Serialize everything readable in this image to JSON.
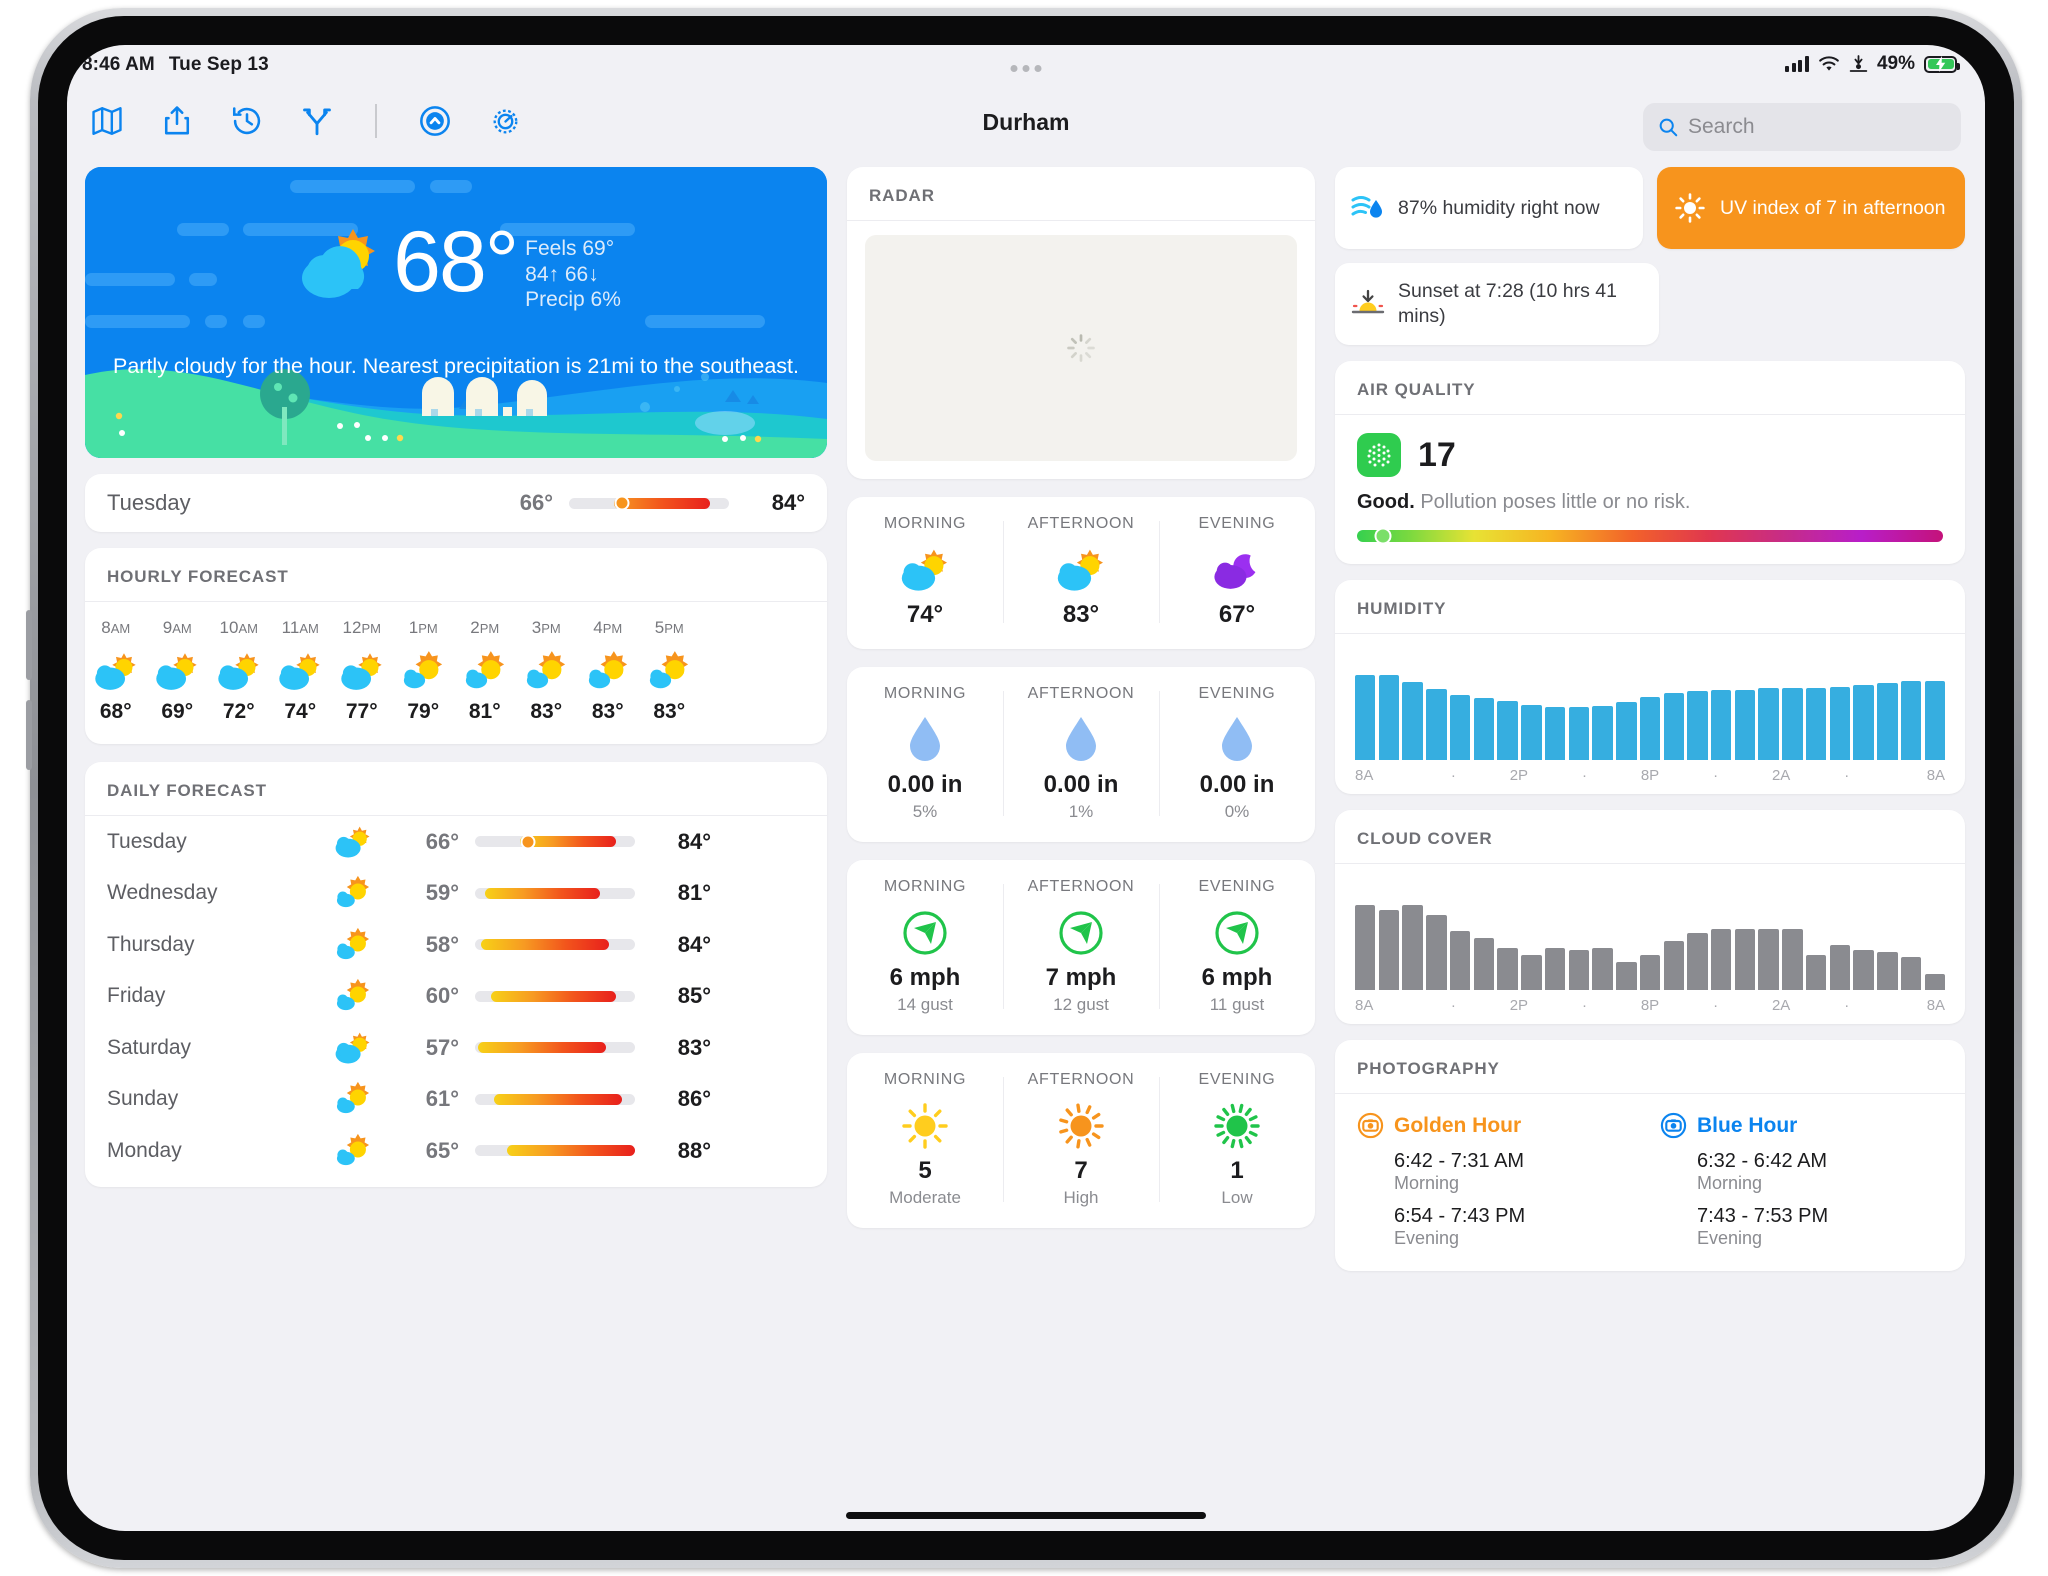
{
  "status_bar": {
    "time": "8:46 AM",
    "date": "Tue Sep 13",
    "battery": "49%"
  },
  "toolbar": {
    "icons": [
      "map-icon",
      "share-icon",
      "history-icon",
      "fork-icon",
      "compass-up-icon",
      "gear-icon"
    ],
    "location_title": "Durham"
  },
  "search": {
    "placeholder": "Search"
  },
  "hero": {
    "temperature": "68°",
    "feels": "Feels 69°",
    "highlow": "84↑ 66↓",
    "precip": "Precip 6%",
    "description": "Partly cloudy for the hour. Nearest precipitation is 21mi to the southeast."
  },
  "today_bar": {
    "day": "Tuesday",
    "low": "66°",
    "high": "84°"
  },
  "hourly": {
    "title": "HOURLY FORECAST",
    "items": [
      {
        "hour": "8",
        "ampm": "AM",
        "temp": "68°",
        "icon": "partly-cloudy-icon"
      },
      {
        "hour": "9",
        "ampm": "AM",
        "temp": "69°",
        "icon": "partly-cloudy-icon"
      },
      {
        "hour": "10",
        "ampm": "AM",
        "temp": "72°",
        "icon": "partly-cloudy-icon"
      },
      {
        "hour": "11",
        "ampm": "AM",
        "temp": "74°",
        "icon": "partly-cloudy-icon"
      },
      {
        "hour": "12",
        "ampm": "PM",
        "temp": "77°",
        "icon": "partly-cloudy-icon"
      },
      {
        "hour": "1",
        "ampm": "PM",
        "temp": "79°",
        "icon": "mostly-sunny-icon"
      },
      {
        "hour": "2",
        "ampm": "PM",
        "temp": "81°",
        "icon": "mostly-sunny-icon"
      },
      {
        "hour": "3",
        "ampm": "PM",
        "temp": "83°",
        "icon": "mostly-sunny-icon"
      },
      {
        "hour": "4",
        "ampm": "PM",
        "temp": "83°",
        "icon": "mostly-sunny-icon"
      },
      {
        "hour": "5",
        "ampm": "PM",
        "temp": "83°",
        "icon": "mostly-sunny-icon"
      }
    ]
  },
  "daily": {
    "title": "DAILY FORECAST",
    "rows": [
      {
        "day": "Tuesday",
        "low": "66°",
        "high": "84°",
        "icon": "partly-cloudy-icon",
        "bar_start": 28,
        "bar_end": 88,
        "dot": 33
      },
      {
        "day": "Wednesday",
        "low": "59°",
        "high": "81°",
        "icon": "mostly-sunny-icon",
        "bar_start": 6,
        "bar_end": 78,
        "dot": null
      },
      {
        "day": "Thursday",
        "low": "58°",
        "high": "84°",
        "icon": "mostly-sunny-icon",
        "bar_start": 4,
        "bar_end": 84,
        "dot": null
      },
      {
        "day": "Friday",
        "low": "60°",
        "high": "85°",
        "icon": "mostly-sunny-icon",
        "bar_start": 10,
        "bar_end": 88,
        "dot": null
      },
      {
        "day": "Saturday",
        "low": "57°",
        "high": "83°",
        "icon": "partly-cloudy-icon",
        "bar_start": 2,
        "bar_end": 82,
        "dot": null
      },
      {
        "day": "Sunday",
        "low": "61°",
        "high": "86°",
        "icon": "mostly-sunny-icon",
        "bar_start": 12,
        "bar_end": 92,
        "dot": null
      },
      {
        "day": "Monday",
        "low": "65°",
        "high": "88°",
        "icon": "mostly-sunny-icon",
        "bar_start": 20,
        "bar_end": 100,
        "dot": null
      }
    ]
  },
  "radar": {
    "title": "RADAR",
    "state": "loading"
  },
  "periods": [
    "MORNING",
    "AFTERNOON",
    "EVENING"
  ],
  "temps_panel": {
    "values": [
      "74°",
      "83°",
      "67°"
    ],
    "icons": [
      "partly-cloudy-icon",
      "partly-cloudy-icon",
      "partly-cloudy-night-icon"
    ]
  },
  "precip_panel": {
    "values": [
      "0.00 in",
      "0.00 in",
      "0.00 in"
    ],
    "subs": [
      "5%",
      "1%",
      "0%"
    ],
    "icon": "raindrop-icon"
  },
  "wind_panel": {
    "values": [
      "6 mph",
      "7 mph",
      "6 mph"
    ],
    "subs": [
      "14 gust",
      "12 gust",
      "11 gust"
    ],
    "icon": "wind-compass-icon"
  },
  "uv_panel": {
    "values": [
      "5",
      "7",
      "1"
    ],
    "subs": [
      "Moderate",
      "High",
      "Low"
    ],
    "icons": [
      "uv-sun-yellow-icon",
      "uv-sun-orange-icon",
      "uv-sun-green-icon"
    ]
  },
  "chips": {
    "humidity": {
      "text": "87% humidity right now",
      "icon": "humidity-icon"
    },
    "uv": {
      "text": "UV index of 7 in afternoon",
      "icon": "sun-icon",
      "color": "#f7941d"
    },
    "sunset": {
      "text": "Sunset at 7:28 (10 hrs 41 mins)",
      "icon": "sunset-icon"
    }
  },
  "air_quality": {
    "title": "AIR QUALITY",
    "value": "17",
    "label": "Good.",
    "description": " Pollution poses little or no risk.",
    "badge_color": "#2fcc4f",
    "marker_pct": 4.5
  },
  "photography": {
    "title": "PHOTOGRAPHY",
    "golden": {
      "label": "Golden Hour",
      "color": "#f7941d",
      "morning": "6:42 - 7:31 AM",
      "morning_label": "Morning",
      "evening": "6:54 - 7:43 PM",
      "evening_label": "Evening"
    },
    "blue": {
      "label": "Blue Hour",
      "color": "#0b84ef",
      "morning": "6:32 - 6:42 AM",
      "morning_label": "Morning",
      "evening": "7:43 - 7:53 PM",
      "evening_label": "Evening"
    }
  },
  "chart_data": [
    {
      "type": "bar",
      "title": "HUMIDITY",
      "color": "#36aee0",
      "xlabel": "",
      "ylabel": "",
      "ylim": [
        0,
        100
      ],
      "grid": false,
      "legend": "none",
      "categories": [
        "8A",
        "9A",
        "10A",
        "11A",
        "12P",
        "1P",
        "2P",
        "3P",
        "4P",
        "5P",
        "6P",
        "7P",
        "8P",
        "9P",
        "10P",
        "11P",
        "12A",
        "1A",
        "2A",
        "3A",
        "4A",
        "5A",
        "6A",
        "7A",
        "8A"
      ],
      "tick_labels": [
        "8A",
        "·",
        "2P",
        "·",
        "8P",
        "·",
        "2A",
        "·",
        "8A"
      ],
      "values": [
        87,
        87,
        80,
        73,
        67,
        64,
        60,
        56,
        54,
        54,
        55,
        59,
        65,
        69,
        71,
        72,
        72,
        74,
        74,
        74,
        75,
        77,
        79,
        81,
        81
      ]
    },
    {
      "type": "bar",
      "title": "CLOUD COVER",
      "color": "#8a8b90",
      "xlabel": "",
      "ylabel": "",
      "ylim": [
        0,
        100
      ],
      "grid": false,
      "legend": "none",
      "categories": [
        "8A",
        "9A",
        "10A",
        "11A",
        "12P",
        "1P",
        "2P",
        "3P",
        "4P",
        "5P",
        "6P",
        "7P",
        "8P",
        "9P",
        "10P",
        "11P",
        "12A",
        "1A",
        "2A",
        "3A",
        "4A",
        "5A",
        "6A",
        "7A",
        "8A"
      ],
      "tick_labels": [
        "8A",
        "·",
        "2P",
        "·",
        "8P",
        "·",
        "2A",
        "·",
        "8A"
      ],
      "values": [
        36,
        34,
        36,
        32,
        25,
        22,
        18,
        15,
        18,
        17,
        18,
        12,
        15,
        21,
        24,
        26,
        26,
        26,
        26,
        15,
        19,
        17,
        16,
        14,
        7
      ]
    }
  ]
}
